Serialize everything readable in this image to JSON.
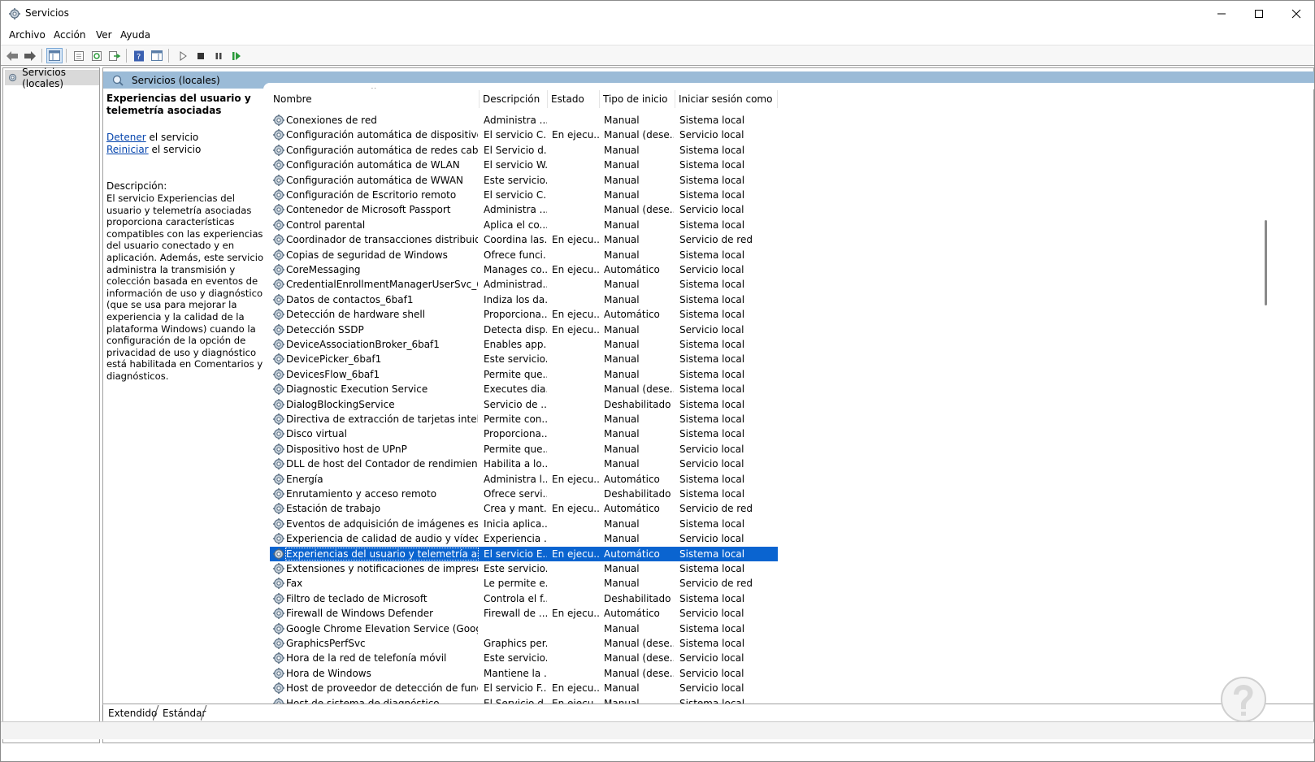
{
  "window": {
    "title": "Servicios",
    "controls": {
      "minimize": "–",
      "maximize": "☐",
      "close": "✕"
    }
  },
  "menu": [
    "Archivo",
    "Acción",
    "Ver",
    "Ayuda"
  ],
  "toolbar": {
    "buttons": [
      "back-icon",
      "forward-icon",
      "show-hide-console-tree-icon",
      "properties-icon",
      "refresh-icon",
      "export-list-icon",
      "help-icon",
      "show-action-pane-icon",
      "start-service-icon",
      "stop-service-icon",
      "pause-service-icon",
      "restart-service-icon"
    ]
  },
  "tree": {
    "root_label": "Servicios (locales)"
  },
  "pane": {
    "header": "Servicios (locales)"
  },
  "details": {
    "service_title": "Experiencias del usuario y telemetría asociadas",
    "stop_link": "Detener",
    "stop_suffix": " el servicio",
    "restart_link": "Reiniciar",
    "restart_suffix": " el servicio",
    "description_label": "Descripción:",
    "description": "El servicio Experiencias del usuario y telemetría asociadas proporciona características compatibles con las experiencias del usuario conectado y en aplicación. Además, este servicio administra la transmisión y colección basada en eventos de información de uso y diagnóstico (que se usa para mejorar la experiencia y la calidad de la plataforma Windows) cuando la configuración de la opción de privacidad de uso y diagnóstico está habilitada en Comentarios y diagnósticos."
  },
  "columns": [
    "Nombre",
    "Descripción",
    "Estado",
    "Tipo de inicio",
    "Iniciar sesión como"
  ],
  "rows": [
    [
      "Conexiones de red",
      "Administra ...",
      "",
      "Manual",
      "Sistema local"
    ],
    [
      "Configuración automática de dispositivos c...",
      "El servicio C...",
      "En ejecu...",
      "Manual (dese...",
      "Servicio local"
    ],
    [
      "Configuración automática de redes cableadas",
      "El Servicio d...",
      "",
      "Manual",
      "Sistema local"
    ],
    [
      "Configuración automática de WLAN",
      "El servicio W...",
      "",
      "Manual",
      "Sistema local"
    ],
    [
      "Configuración automática de WWAN",
      "Este servicio...",
      "",
      "Manual",
      "Sistema local"
    ],
    [
      "Configuración de Escritorio remoto",
      "El servicio C...",
      "",
      "Manual",
      "Sistema local"
    ],
    [
      "Contenedor de Microsoft Passport",
      "Administra ...",
      "",
      "Manual (dese...",
      "Servicio local"
    ],
    [
      "Control parental",
      "Aplica el co...",
      "",
      "Manual",
      "Sistema local"
    ],
    [
      "Coordinador de transacciones distribuidas",
      "Coordina las...",
      "En ejecu...",
      "Manual",
      "Servicio de red"
    ],
    [
      "Copias de seguridad de Windows",
      "Ofrece funci...",
      "",
      "Manual",
      "Sistema local"
    ],
    [
      "CoreMessaging",
      "Manages co...",
      "En ejecu...",
      "Automático",
      "Servicio local"
    ],
    [
      "CredentialEnrollmentManagerUserSvc_6baf1",
      "Administrad...",
      "",
      "Manual",
      "Sistema local"
    ],
    [
      "Datos de contactos_6baf1",
      "Indiza los da...",
      "",
      "Manual",
      "Sistema local"
    ],
    [
      "Detección de hardware shell",
      "Proporciona...",
      "En ejecu...",
      "Automático",
      "Sistema local"
    ],
    [
      "Detección SSDP",
      "Detecta disp...",
      "En ejecu...",
      "Manual",
      "Servicio local"
    ],
    [
      "DeviceAssociationBroker_6baf1",
      "Enables app...",
      "",
      "Manual",
      "Sistema local"
    ],
    [
      "DevicePicker_6baf1",
      "Este servicio...",
      "",
      "Manual",
      "Sistema local"
    ],
    [
      "DevicesFlow_6baf1",
      "Permite que...",
      "",
      "Manual",
      "Sistema local"
    ],
    [
      "Diagnostic Execution Service",
      "Executes dia...",
      "",
      "Manual (dese...",
      "Sistema local"
    ],
    [
      "DialogBlockingService",
      "Servicio de ...",
      "",
      "Deshabilitado",
      "Sistema local"
    ],
    [
      "Directiva de extracción de tarjetas inteligentes",
      "Permite con...",
      "",
      "Manual",
      "Sistema local"
    ],
    [
      "Disco virtual",
      "Proporciona...",
      "",
      "Manual",
      "Sistema local"
    ],
    [
      "Dispositivo host de UPnP",
      "Permite que...",
      "",
      "Manual",
      "Servicio local"
    ],
    [
      "DLL de host del Contador de rendimiento",
      "Habilita a lo...",
      "",
      "Manual",
      "Servicio local"
    ],
    [
      "Energía",
      "Administra l...",
      "En ejecu...",
      "Automático",
      "Sistema local"
    ],
    [
      "Enrutamiento y acceso remoto",
      "Ofrece servi...",
      "",
      "Deshabilitado",
      "Sistema local"
    ],
    [
      "Estación de trabajo",
      "Crea y mant...",
      "En ejecu...",
      "Automático",
      "Servicio de red"
    ],
    [
      "Eventos de adquisición de imágenes estáticas",
      "Inicia aplica...",
      "",
      "Manual",
      "Sistema local"
    ],
    [
      "Experiencia de calidad de audio y vídeo de ...",
      "Experiencia ...",
      "",
      "Manual",
      "Servicio local"
    ],
    [
      "Experiencias del usuario y telemetría asociad...",
      "El servicio E...",
      "En ejecu...",
      "Automático",
      "Sistema local"
    ],
    [
      "Extensiones y notificaciones de impresora",
      "Este servicio...",
      "",
      "Manual",
      "Sistema local"
    ],
    [
      "Fax",
      "Le permite e...",
      "",
      "Manual",
      "Servicio de red"
    ],
    [
      "Filtro de teclado de Microsoft",
      "Controla el f...",
      "",
      "Deshabilitado",
      "Sistema local"
    ],
    [
      "Firewall de Windows Defender",
      "Firewall de ...",
      "En ejecu...",
      "Automático",
      "Servicio local"
    ],
    [
      "Google Chrome Elevation Service (GoogleC...",
      "",
      "",
      "Manual",
      "Sistema local"
    ],
    [
      "GraphicsPerfSvc",
      "Graphics per...",
      "",
      "Manual (dese...",
      "Sistema local"
    ],
    [
      "Hora de la red de telefonía móvil",
      "Este servicio...",
      "",
      "Manual (dese...",
      "Servicio local"
    ],
    [
      "Hora de Windows",
      "Mantiene la ...",
      "",
      "Manual (dese...",
      "Servicio local"
    ],
    [
      "Host de proveedor de detección de función",
      "El servicio F...",
      "En ejecu...",
      "Manual",
      "Servicio local"
    ],
    [
      "Host de sistema de diagnóstico",
      "El Servicio d...",
      "En ejecu...",
      "Manual",
      "Sistema local"
    ]
  ],
  "selected_row": 29,
  "tabs": [
    "Extendido",
    "Estándar"
  ],
  "colors": {
    "header_bar": "#9bbbd7",
    "selection": "#0a64d0",
    "link": "#0645ad"
  }
}
